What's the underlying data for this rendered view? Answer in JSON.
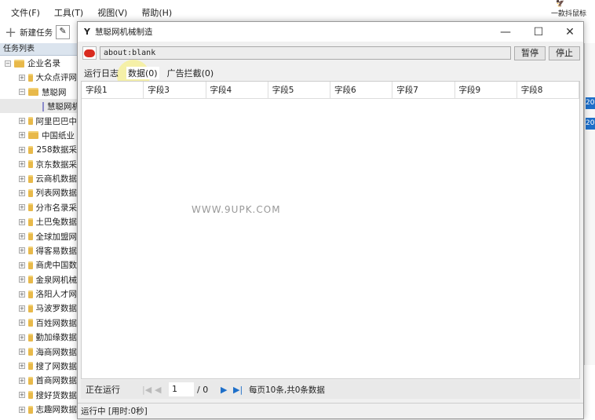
{
  "menu": [
    "文件(F)",
    "工具(T)",
    "视图(V)",
    "帮助(H)"
  ],
  "toolbar": {
    "new_task": "新建任务"
  },
  "logo": {
    "tagline": "一款抖鼠标"
  },
  "tasklist": {
    "header": "任务列表",
    "root": "企业名录",
    "items": [
      "大众点评网",
      "慧聪网",
      "慧聪网机械",
      "阿里巴巴中",
      "中国纸业",
      "258数据采",
      "京东数据采",
      "云商机数据",
      "列表网数据",
      "分市名录采",
      "土巴兔数据",
      "全球加盟网",
      "得客易数据",
      "商虎中国数",
      "金泉网机械",
      "洛阳人才网",
      "马波罗数据",
      "百姓网数据",
      "勤加缘数据",
      "海商网数据",
      "搜了网数据",
      "首商网数据",
      "搜好货数据",
      "志趣网数据"
    ]
  },
  "right_strip": [
    "20",
    "20"
  ],
  "dialog": {
    "title": "慧聪网机械制造",
    "url": "about:blank",
    "pause": "暂停",
    "stop": "停止",
    "tabs": [
      "运行日志",
      "数据(0)",
      "广告拦截(0)"
    ],
    "columns": [
      "字段1",
      "字段3",
      "字段4",
      "字段5",
      "字段6",
      "字段7",
      "字段9",
      "字段8"
    ],
    "watermark": "WWW.9UPK.COM",
    "pager": {
      "status": "正在运行",
      "page": "1",
      "total": "/ 0",
      "summary": "每页10条,共0条数据"
    },
    "statusbar": "运行中  [用时:0秒]"
  }
}
